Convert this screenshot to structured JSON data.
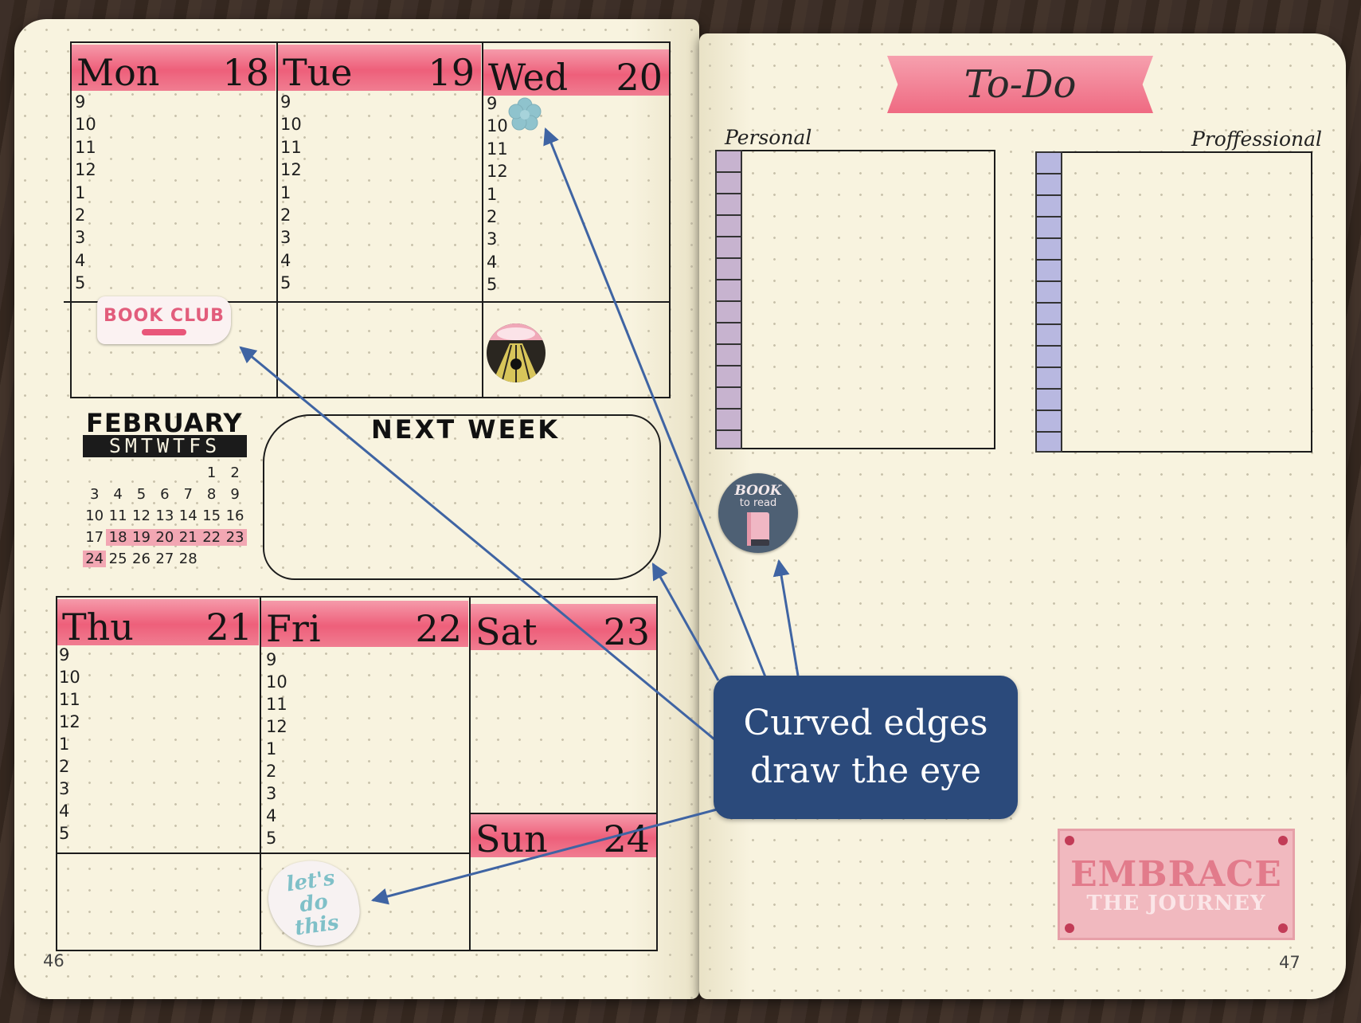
{
  "week_top": [
    {
      "day": "Mon",
      "date": "18"
    },
    {
      "day": "Tue",
      "date": "19"
    },
    {
      "day": "Wed",
      "date": "20"
    }
  ],
  "week_bottom": [
    {
      "day": "Thu",
      "date": "21"
    },
    {
      "day": "Fri",
      "date": "22"
    },
    {
      "day": "Sat",
      "date": "23"
    }
  ],
  "sunday": {
    "day": "Sun",
    "date": "24"
  },
  "hours": [
    "9",
    "10",
    "11",
    "12",
    "1",
    "2",
    "3",
    "4",
    "5"
  ],
  "stickers": {
    "book_club": "BOOK CLUB",
    "book_to_read_1": "BOOK",
    "book_to_read_2": "to read",
    "lets_do_this": "let's do this",
    "embrace_1": "EMBRACE",
    "embrace_2": "THE JOURNEY"
  },
  "mini_calendar": {
    "month": "FEBRUARY",
    "weekdays": "SMTWTFS",
    "weeks": [
      [
        "",
        "",
        "",
        "",
        "",
        "1",
        "2"
      ],
      [
        "3",
        "4",
        "5",
        "6",
        "7",
        "8",
        "9"
      ],
      [
        "10",
        "11",
        "12",
        "13",
        "14",
        "15",
        "16"
      ],
      [
        "17",
        "18",
        "19",
        "20",
        "21",
        "22",
        "23"
      ],
      [
        "24",
        "25",
        "26",
        "27",
        "28",
        "",
        ""
      ]
    ],
    "highlighted": [
      "18",
      "19",
      "20",
      "21",
      "22",
      "23",
      "24"
    ]
  },
  "next_week": {
    "title": "NEXT WEEK"
  },
  "todo": {
    "title": "To-Do",
    "personal": "Personal",
    "professional": "Proffessional"
  },
  "callout": {
    "line1": "Curved edges",
    "line2": "draw the eye"
  },
  "page_numbers": {
    "left": "46",
    "right": "47"
  },
  "colors": {
    "highlight_pink": "#ee5f7a",
    "callout_blue": "#2b4a7b",
    "arrow_blue": "#3f64a3",
    "lavender": "#b8b8e0"
  }
}
